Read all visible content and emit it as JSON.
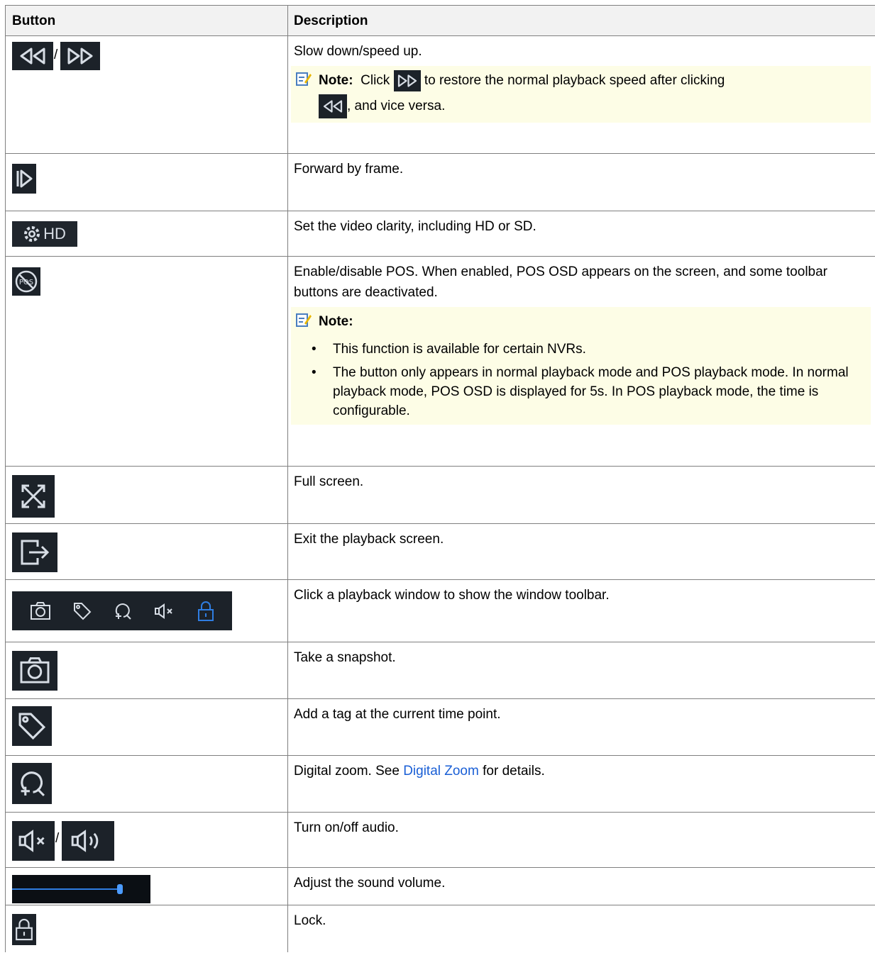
{
  "table": {
    "header": {
      "button": "Button",
      "description": "Description"
    },
    "rows": [
      {
        "icons": [
          "slow-down-icon",
          "speed-up-icon"
        ],
        "separator": "/",
        "description": "Slow down/speed up.",
        "note": {
          "label": "Note:",
          "pre": "Click",
          "mid": "to restore the normal playback speed after clicking",
          "post": ", and vice versa."
        }
      },
      {
        "icons": [
          "frame-forward-icon"
        ],
        "description": "Forward by frame."
      },
      {
        "icons": [
          "video-clarity-icon"
        ],
        "icon_text": "HD",
        "description": "Set the video clarity, including HD or SD."
      },
      {
        "icons": [
          "pos-icon"
        ],
        "icon_text": "POS",
        "description": "Enable/disable POS. When enabled, POS OSD appears on the screen, and some toolbar buttons are deactivated.",
        "note": {
          "label": "Note:",
          "items": [
            "This function is available for certain NVRs.",
            "The button only appears in normal playback mode and POS playback mode. In normal playback mode, POS OSD is displayed for 5s. In POS playback mode, the time is configurable."
          ]
        }
      },
      {
        "icons": [
          "full-screen-icon"
        ],
        "description": "Full screen."
      },
      {
        "icons": [
          "exit-icon"
        ],
        "description": "Exit the playback screen."
      },
      {
        "icons": [
          "window-toolbar-icon"
        ],
        "description": "Click a playback window to show the window toolbar."
      },
      {
        "icons": [
          "snapshot-icon"
        ],
        "description": "Take a snapshot."
      },
      {
        "icons": [
          "tag-icon"
        ],
        "description": "Add a tag at the current time point."
      },
      {
        "icons": [
          "digital-zoom-icon"
        ],
        "description_pre": "Digital zoom. See ",
        "link": "Digital Zoom",
        "description_post": " for details."
      },
      {
        "icons": [
          "audio-off-icon",
          "audio-on-icon"
        ],
        "separator": "/",
        "description": "Turn on/off audio."
      },
      {
        "icons": [
          "volume-slider"
        ],
        "volume_level": 0.78,
        "description": "Adjust the sound volume."
      },
      {
        "icons": [
          "lock-icon"
        ],
        "description": "Lock."
      }
    ]
  },
  "colors": {
    "icon_bg": "#1c2229",
    "icon_fg": "#d7dde5",
    "accent_blue": "#2f7de1",
    "note_bg": "#fdfde6",
    "header_bg": "#f2f2f2",
    "link": "#1a5fd6"
  }
}
